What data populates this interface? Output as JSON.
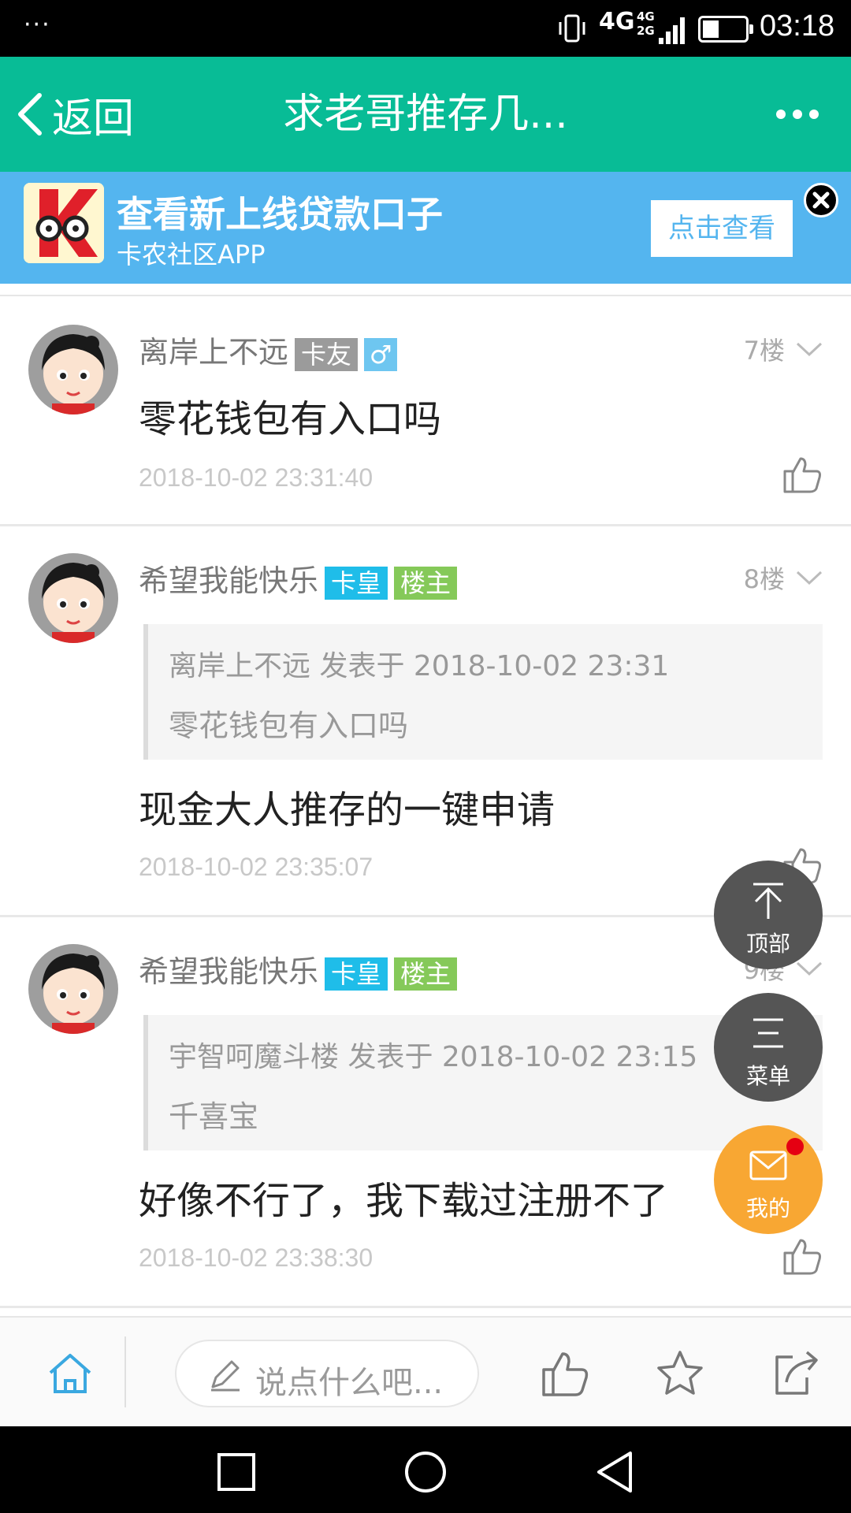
{
  "status_bar": {
    "menu_dots": "···",
    "network": "4G",
    "network2": "4G\n2G",
    "time": "03:18"
  },
  "title_bar": {
    "back_label": "返回",
    "title": "求老哥推存几..."
  },
  "ad": {
    "headline": "查看新上线贷款口子",
    "subtitle": "卡农社区APP",
    "button": "点击查看"
  },
  "posts": [
    {
      "username": "离岸上不远",
      "badges": [
        "卡友"
      ],
      "gender": "♂",
      "floor": "7楼",
      "content": "零花钱包有入口吗",
      "timestamp": "2018-10-02 23:31:40"
    },
    {
      "username": "希望我能快乐",
      "badges": [
        "卡皇",
        "楼主"
      ],
      "floor": "8楼",
      "quote_header": "离岸上不远 发表于 2018-10-02 23:31",
      "quote_body": "零花钱包有入口吗",
      "content": "现金大人推存的一键申请",
      "timestamp": "2018-10-02 23:35:07"
    },
    {
      "username": "希望我能快乐",
      "badges": [
        "卡皇",
        "楼主"
      ],
      "floor": "9楼",
      "quote_header": "宇智呵魔斗楼 发表于 2018-10-02 23:15",
      "quote_body": "千喜宝",
      "content": "好像不行了，我下载过注册不了",
      "timestamp": "2018-10-02 23:38:30"
    }
  ],
  "floating": {
    "top_label": "顶部",
    "menu_label": "菜单",
    "mine_label": "我的"
  },
  "toolbar": {
    "input_placeholder": "说点什么吧..."
  },
  "colors": {
    "title_bar": "#08bc96",
    "ad_bg": "#54b5ef",
    "badge_gray": "#9b9b9b",
    "badge_blue": "#1fbde9",
    "badge_green": "#85c959",
    "fab_orange": "#f8a733"
  }
}
